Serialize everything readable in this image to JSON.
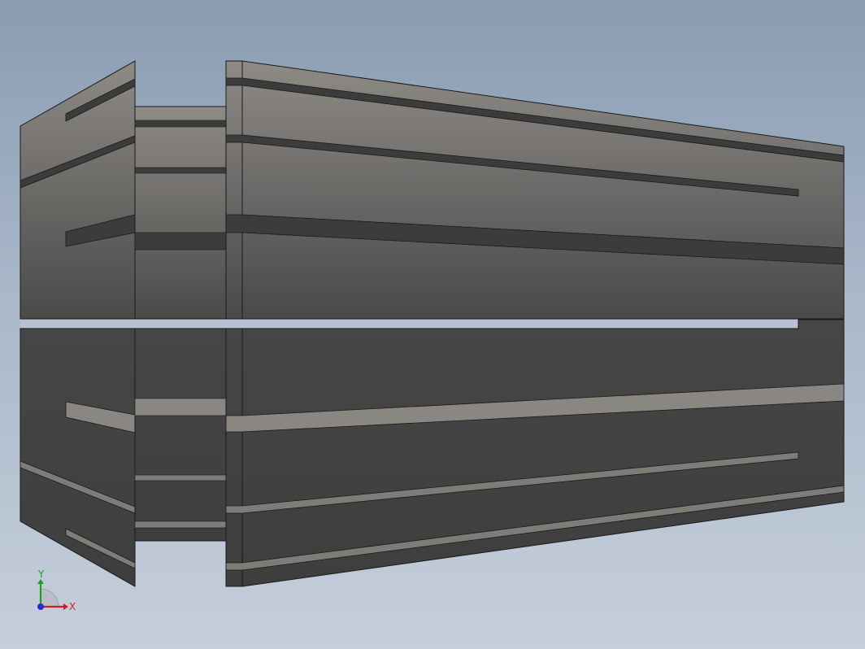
{
  "viewport": {
    "background_top": "#8a9cb2",
    "background_bottom": "#c6cfdb",
    "model": "collet-part",
    "colors": {
      "face_light": "#8e8b86",
      "face_mid": "#5e5c59",
      "face_dark": "#454545",
      "slot_dark": "#3a3a3a",
      "slot_light": "#8a8782",
      "edge": "#1a1a1a"
    }
  },
  "triad": {
    "x_label": "X",
    "y_label": "Y",
    "x_color": "#cc1f1f",
    "y_color": "#1f9e2a",
    "z_color": "#1f2fcc"
  }
}
